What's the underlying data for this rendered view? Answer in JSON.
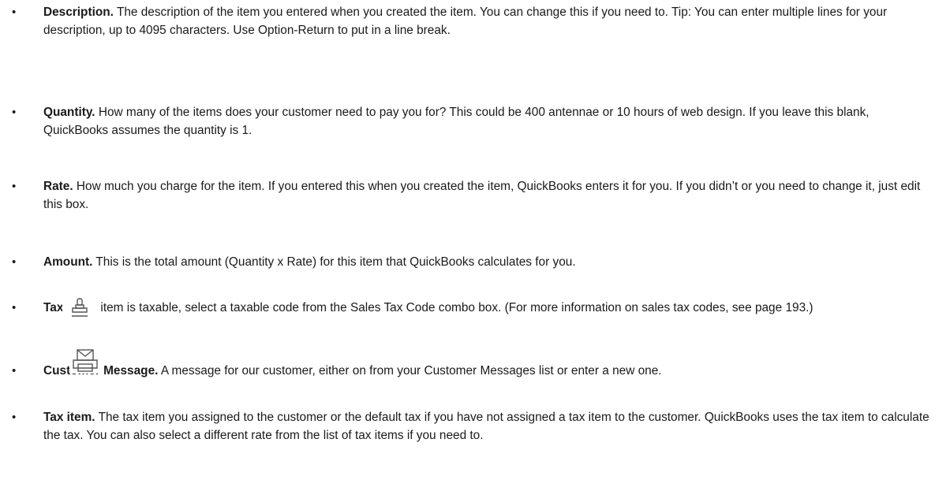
{
  "items": [
    {
      "term": "Description.",
      "text": " The description of the item you entered when you created the item. You can change this if you need to. Tip: You can enter multiple lines for your description, up to 4095 characters. Use Option-Return to put in a line break."
    },
    {
      "term": "Quantity.",
      "text": " How many of the items does your customer need to pay you for? This could be 400 antennae or 10 hours of web design. If you leave this blank, QuickBooks assumes the quantity is 1."
    },
    {
      "term": "Rate.",
      "text": " How much you charge for the item. If you entered this when you created the item, QuickBooks enters it for you. If you didn’t or you need to change it, just edit this box."
    },
    {
      "term": "Amount.",
      "text": " This is the total amount (Quantity x Rate) for this item that QuickBooks calculates for you."
    },
    {
      "term": "Tax.",
      "text": " If the item is taxable, select a taxable code from the Sales Tax Code combo box. (For more information on sales tax codes, see page 193.)"
    },
    {
      "term": "Customer Message.",
      "text": " A message for our customer, either on from your Customer Messages list or enter a new one."
    },
    {
      "term": "Tax item.",
      "text": " The tax item you assigned to the customer or the default tax if you have not assigned a tax item to the customer. QuickBooks uses the tax item to calculate the tax. You can also select a different rate from the list of tax items if you need to."
    }
  ],
  "bullet": "•",
  "icons": [
    "stamp-icon",
    "print-email-icon"
  ]
}
